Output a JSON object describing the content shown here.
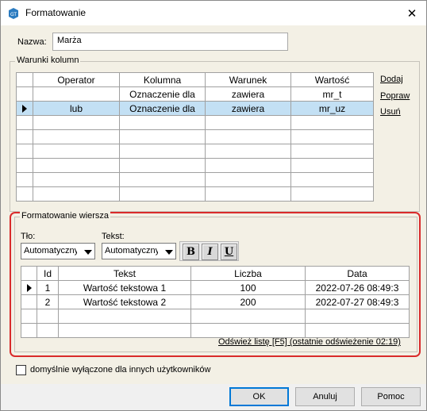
{
  "window": {
    "title": "Formatowanie",
    "close_glyph": "✕",
    "app_icon_text": "GT"
  },
  "name_field": {
    "label": "Nazwa:",
    "value": "Marża"
  },
  "conditions": {
    "group_title": "Warunki kolumn",
    "headers": [
      "",
      "Operator",
      "Kolumna",
      "Warunek",
      "Wartość"
    ],
    "rows": [
      {
        "current": false,
        "selected": false,
        "cells": [
          "",
          "Oznaczenie dla",
          "zawiera",
          "mr_t"
        ]
      },
      {
        "current": true,
        "selected": true,
        "cells": [
          "lub",
          "Oznaczenie dla",
          "zawiera",
          "mr_uz"
        ]
      }
    ],
    "empty_rows": 6,
    "links": {
      "add": "Dodaj",
      "edit": "Popraw",
      "delete": "Usuń"
    }
  },
  "row_format": {
    "group_title": "Formatowanie wiersza",
    "background": {
      "label": "Tło:",
      "value": "Automatyczny"
    },
    "text": {
      "label": "Tekst:",
      "value": "Automatyczny"
    },
    "style_buttons": {
      "bold": "B",
      "italic": "I",
      "underline": "U"
    },
    "preview": {
      "headers": [
        "",
        "Id",
        "Tekst",
        "Liczba",
        "Data"
      ],
      "rows": [
        {
          "current": true,
          "cells": [
            "1",
            "Wartość tekstowa 1",
            "100",
            "2022-07-26 08:49:3"
          ]
        },
        {
          "current": false,
          "cells": [
            "2",
            "Wartość tekstowa 2",
            "200",
            "2022-07-27 08:49:3"
          ]
        }
      ]
    },
    "refresh_link": "Odśwież listę [F5] (ostatnie odświeżenie 02:19)"
  },
  "default_off": {
    "checked": false,
    "label": "domyślnie wyłączone dla innych użytkowników"
  },
  "buttons": {
    "ok": "OK",
    "cancel": "Anuluj",
    "help": "Pomoc"
  },
  "colors": {
    "highlight": "#d92b2b",
    "selection": "#c3e0f4",
    "accent": "#0078d7"
  }
}
